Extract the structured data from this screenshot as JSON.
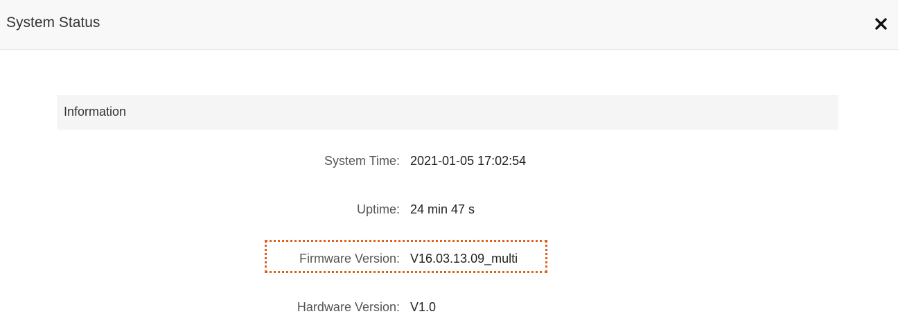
{
  "dialog": {
    "title": "System Status",
    "close_icon": "close-icon"
  },
  "section": {
    "title": "Information"
  },
  "info": {
    "rows": [
      {
        "label": "System Time:",
        "value": "2021-01-05 17:02:54"
      },
      {
        "label": "Uptime:",
        "value": "24 min 47 s"
      },
      {
        "label": "Firmware Version:",
        "value": "V16.03.13.09_multi"
      },
      {
        "label": "Hardware Version:",
        "value": "V1.0"
      }
    ]
  },
  "colors": {
    "header_bg": "#f8f8f8",
    "section_bg": "#f5f5f5",
    "highlight": "#e05f1a"
  }
}
